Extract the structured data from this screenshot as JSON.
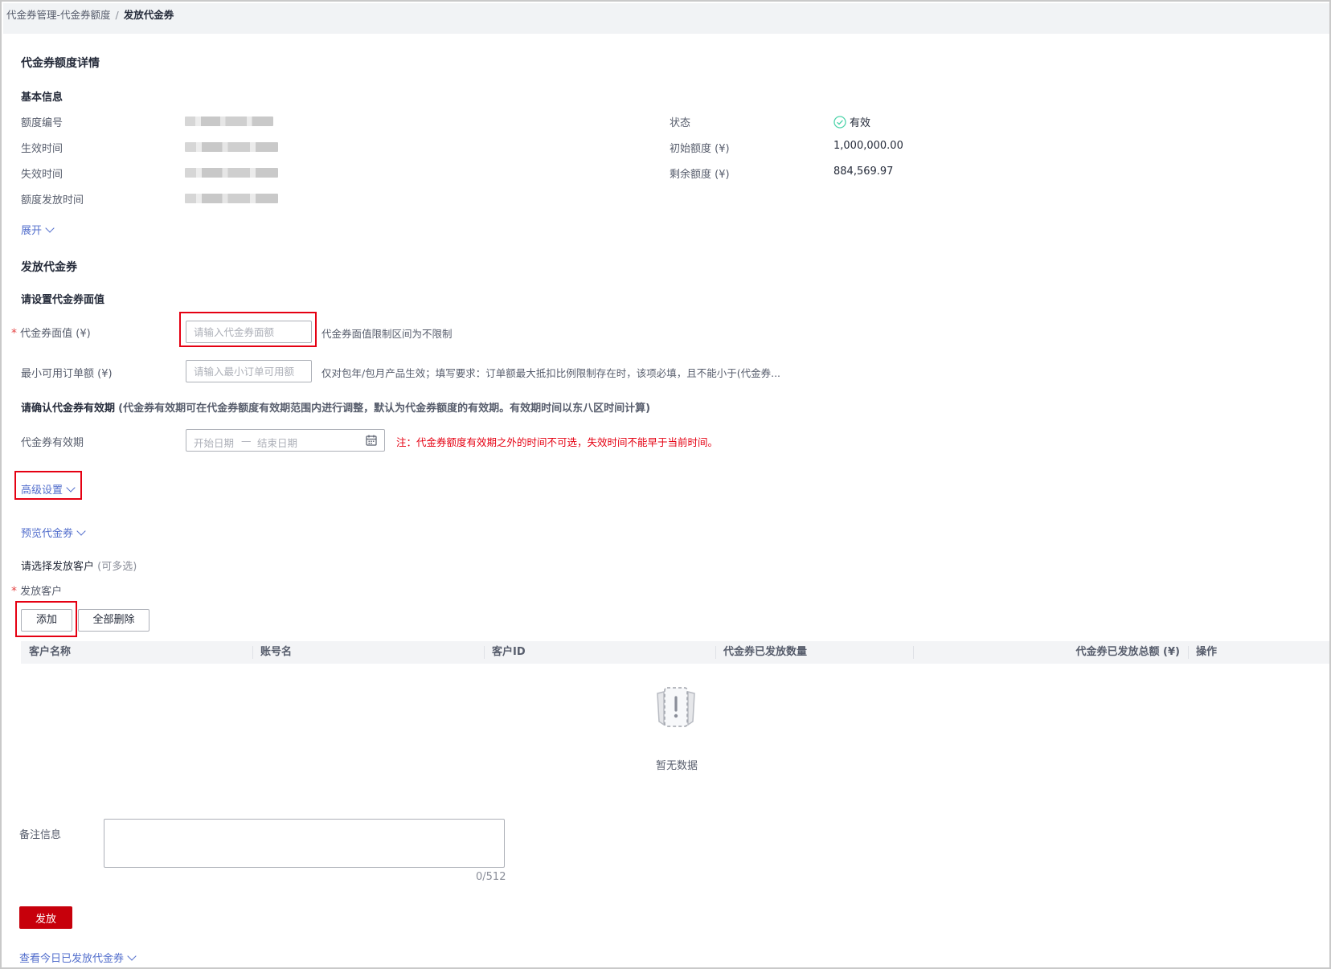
{
  "breadcrumb": {
    "parent": "代金券管理-代金券额度",
    "separator": "/",
    "current": "发放代金券"
  },
  "details": {
    "title": "代金券额度详情",
    "basic_title": "基本信息",
    "left_labels": [
      "额度编号",
      "生效时间",
      "失效时间",
      "额度发放时间"
    ],
    "status_label": "状态",
    "status_value": "有效",
    "initial_label": "初始额度 (¥)",
    "initial_value": "1,000,000.00",
    "remaining_label": "剩余额度 (¥)",
    "remaining_value": "884,569.97",
    "expand_label": "展开"
  },
  "issue": {
    "title": "发放代金券",
    "face_value_section": "请设置代金券面值",
    "face_value_label": "代金券面值 (¥)",
    "face_value_placeholder": "请输入代金券面额",
    "face_value_hint": "代金券面值限制区间为不限制",
    "min_order_label": "最小可用订单额 (¥)",
    "min_order_placeholder": "请输入最小订单可用额",
    "min_order_hint": "仅对包年/包月产品生效；填写要求：订单额最大抵扣比例限制存在时，该项必填，且不能小于(代金券...",
    "validity_section_bold": "请确认代金券有效期",
    "validity_section_note": "(代金券有效期可在代金券额度有效期范围内进行调整，默认为代金券额度的有效期。有效期时间以东八区时间计算)",
    "validity_label": "代金券有效期",
    "start_placeholder": "开始日期",
    "range_sep": "—",
    "end_placeholder": "结束日期",
    "validity_note": "注：代金券额度有效期之外的时间不可选，失效时间不能早于当前时间。",
    "advanced_label": "高级设置",
    "preview_label": "预览代金券",
    "customer_section": "请选择发放客户",
    "customer_section_note": "(可多选)",
    "customer_label": "发放客户",
    "add_button": "添加",
    "delete_all_button": "全部删除"
  },
  "table": {
    "columns": [
      "客户名称",
      "账号名",
      "客户ID",
      "代金券已发放数量",
      "代金券已发放总额 (¥)",
      "操作"
    ],
    "empty_text": "暂无数据"
  },
  "remark": {
    "label": "备注信息",
    "counter": "0/512"
  },
  "submit_label": "发放",
  "today_link": "查看今日已发放代金券",
  "colors": {
    "accent": "#526ecc",
    "primary": "#c7000b",
    "highlight": "#e50012",
    "success": "#50d4ab"
  }
}
